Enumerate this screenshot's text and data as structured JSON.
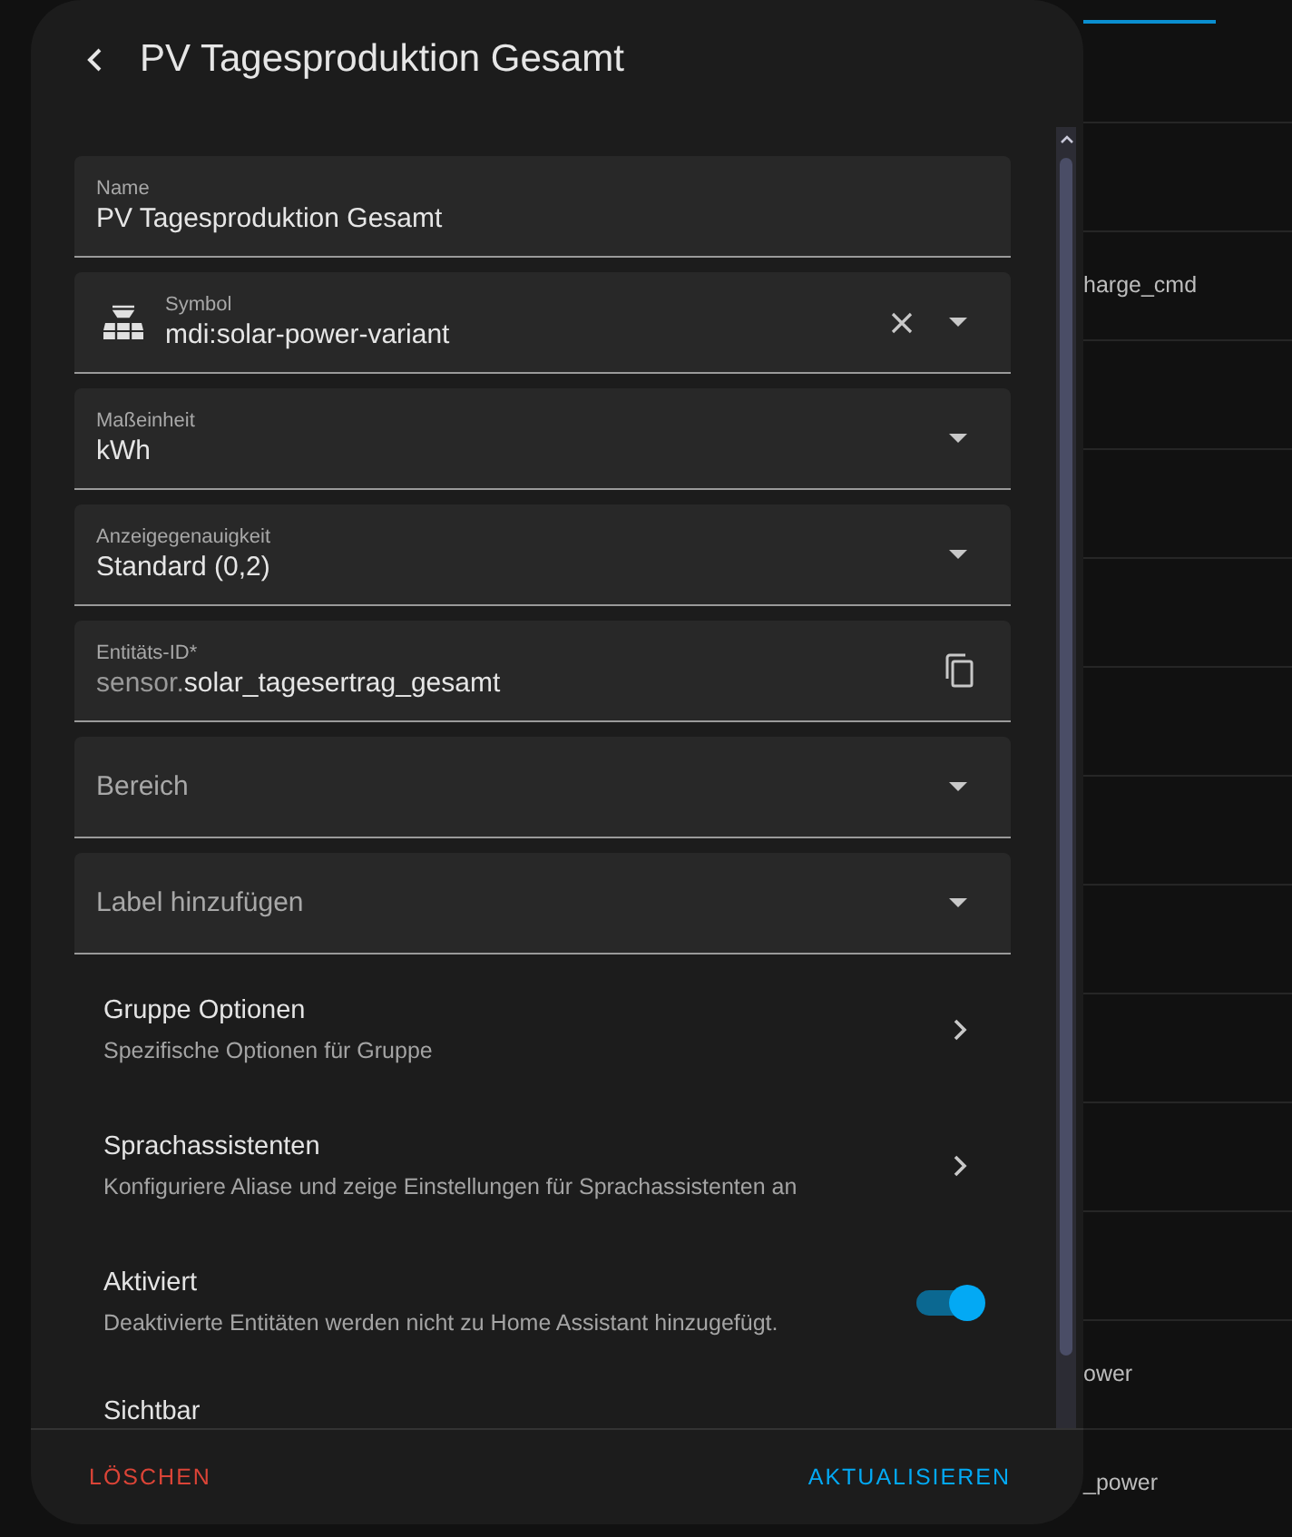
{
  "dialog": {
    "title": "PV Tagesproduktion Gesamt",
    "fields": [
      {
        "kind": "text",
        "label": "Name",
        "value": "PV Tagesproduktion Gesamt"
      },
      {
        "kind": "icon-select",
        "label": "Symbol",
        "value": "mdi:solar-power-variant"
      },
      {
        "kind": "select",
        "label": "Maßeinheit",
        "value": "kWh"
      },
      {
        "kind": "select",
        "label": "Anzeigegenauigkeit",
        "value": "Standard (0,2)"
      },
      {
        "kind": "entity-id",
        "label": "Entitäts-ID*",
        "prefix": "sensor.",
        "value": "solar_tagesertrag_gesamt"
      },
      {
        "kind": "select",
        "placeholder": "Bereich"
      },
      {
        "kind": "select",
        "placeholder": "Label hinzufügen"
      }
    ],
    "items": [
      {
        "kind": "link",
        "title": "Gruppe Optionen",
        "subtitle": "Spezifische Optionen für Gruppe"
      },
      {
        "kind": "link",
        "title": "Sprachassistenten",
        "subtitle": "Konfiguriere Aliase und zeige Einstellungen für Sprachassistenten an"
      },
      {
        "kind": "toggle",
        "title": "Aktiviert",
        "subtitle": "Deaktivierte Entitäten werden nicht zu Home Assistant hinzugefügt.",
        "on": true
      },
      {
        "kind": "heading",
        "title": "Sichtbar"
      }
    ],
    "delete_button": "LÖSCHEN",
    "update_button": "AKTUALISIEREN"
  },
  "background_rows": [
    "harge_cmd",
    "ower",
    "_power"
  ]
}
